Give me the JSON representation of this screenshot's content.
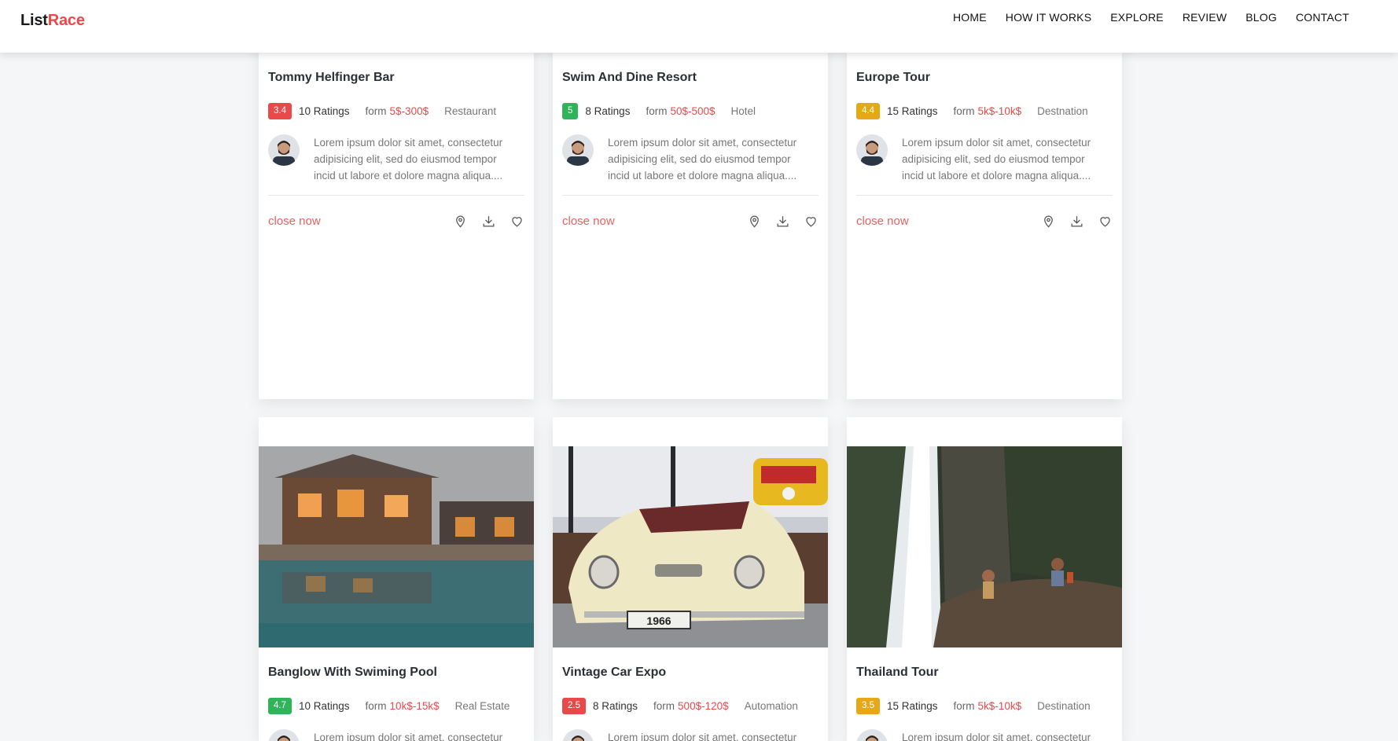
{
  "header": {
    "logo_main": "List",
    "logo_accent": "Race",
    "nav": [
      "HOME",
      "HOW IT WORKS",
      "EXPLORE",
      "REVIEW",
      "BLOG",
      "CONTACT"
    ]
  },
  "colors": {
    "accent": "#e84a4a",
    "badge_red": "#e84a4a",
    "badge_green": "#2fb45a",
    "badge_yellow": "#e6a817"
  },
  "cards": [
    {
      "title": "Tommy Helfinger Bar",
      "rating": "3.4",
      "badge_color": "red",
      "ratings": "10 Ratings",
      "form": "form",
      "price": "5$-300$",
      "category": "Restaurant",
      "description": "Lorem ipsum dolor sit amet, consectetur adipisicing elit, sed do eiusmod tempor incid ut labore et dolore magna aliqua....",
      "status": "close now",
      "image": "bar-interior-image"
    },
    {
      "title": "Swim And Dine Resort",
      "rating": "5",
      "badge_color": "green",
      "ratings": "8 Ratings",
      "form": "form",
      "price": "50$-500$",
      "category": "Hotel",
      "description": "Lorem ipsum dolor sit amet, consectetur adipisicing elit, sed do eiusmod tempor incid ut labore et dolore magna aliqua....",
      "status": "close now",
      "image": "resort-pool-image"
    },
    {
      "title": "Europe Tour",
      "rating": "4.4",
      "badge_color": "yellow",
      "ratings": "15 Ratings",
      "form": "form",
      "price": "5k$-10k$",
      "category": "Destnation",
      "description": "Lorem ipsum dolor sit amet, consectetur adipisicing elit, sed do eiusmod tempor incid ut labore et dolore magna aliqua....",
      "status": "close now",
      "image": "lake-village-image"
    },
    {
      "title": "Banglow With Swiming Pool",
      "rating": "4.7",
      "badge_color": "green",
      "ratings": "10 Ratings",
      "form": "form",
      "price": "10k$-15k$",
      "category": "Real Estate",
      "description": "Lorem ipsum dolor sit amet, consectetur",
      "status": "",
      "image": "bungalow-pool-image"
    },
    {
      "title": "Vintage Car Expo",
      "rating": "2.5",
      "badge_color": "red",
      "ratings": "8 Ratings",
      "form": "form",
      "price": "500$-120$",
      "category": "Automation",
      "description": "Lorem ipsum dolor sit amet, consectetur",
      "status": "",
      "image": "vintage-car-image"
    },
    {
      "title": "Thailand Tour",
      "rating": "3.5",
      "badge_color": "yellow",
      "ratings": "15 Ratings",
      "form": "form",
      "price": "5k$-10k$",
      "category": "Destination",
      "description": "Lorem ipsum dolor sit amet, consectetur",
      "status": "",
      "image": "waterfall-image"
    }
  ]
}
